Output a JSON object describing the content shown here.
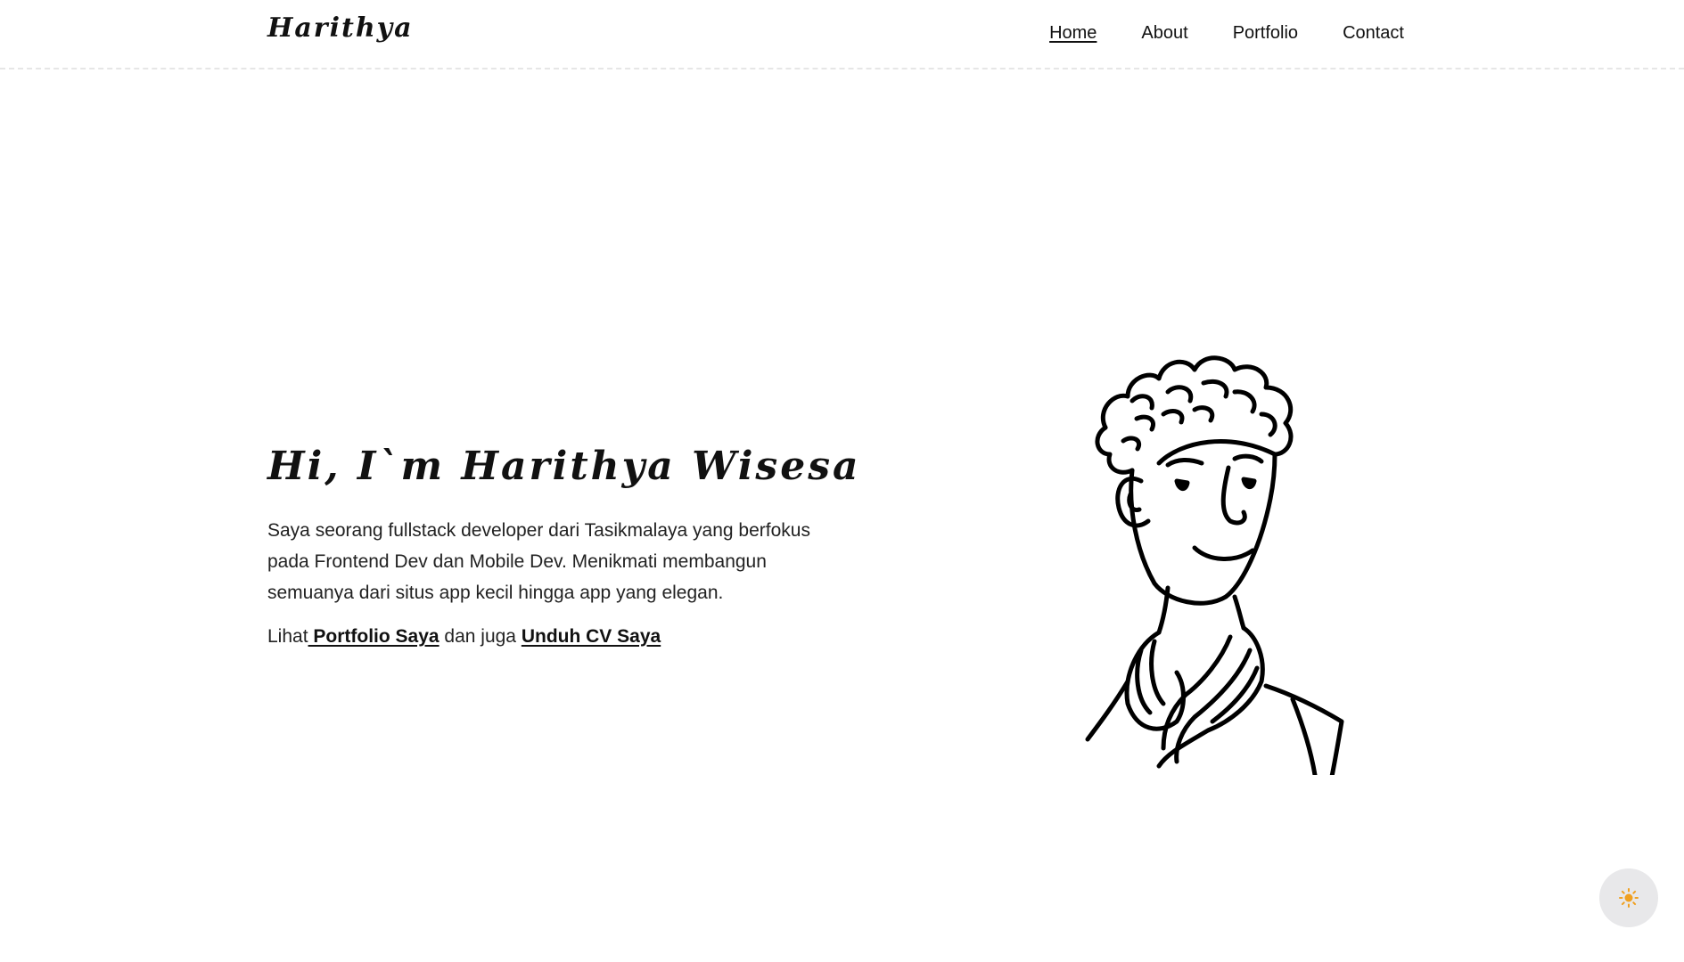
{
  "header": {
    "logo": "Harithya",
    "nav": [
      {
        "label": "Home",
        "active": true
      },
      {
        "label": "About",
        "active": false
      },
      {
        "label": "Portfolio",
        "active": false
      },
      {
        "label": "Contact",
        "active": false
      }
    ]
  },
  "hero": {
    "title": "Hi, I`m Harithya Wisesa",
    "description": "Saya seorang fullstack developer dari Tasikmalaya yang berfokus pada Frontend Dev dan Mobile Dev. Menikmati membangun semuanya dari situs app kecil hingga app yang elegan.",
    "links_prefix": "Lihat",
    "portfolio_link": " Portfolio Saya",
    "links_middle": " dan juga ",
    "cv_link": "Unduh CV Saya"
  },
  "theme_toggle": {
    "icon": "sun-icon",
    "icon_color": "#f0a020"
  }
}
